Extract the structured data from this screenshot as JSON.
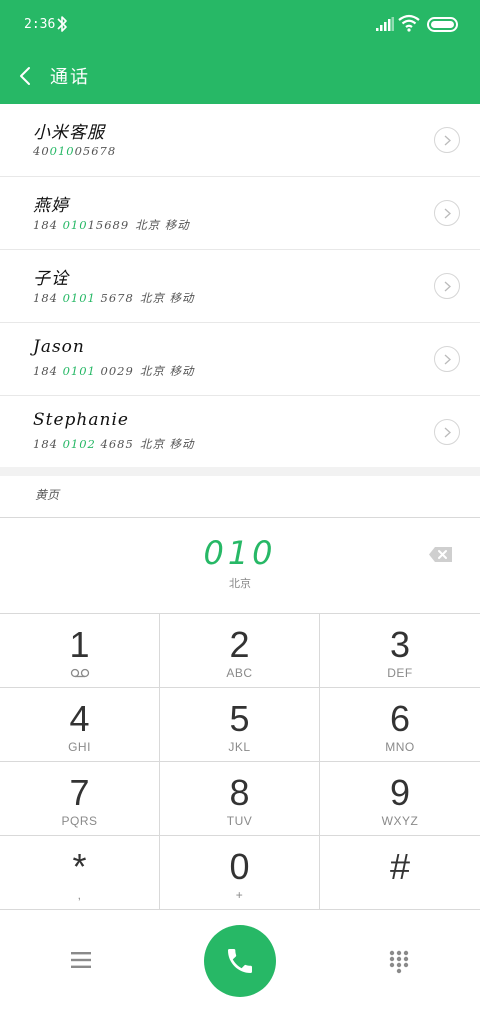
{
  "status_bar": {
    "time": "2:36",
    "icons": [
      "bluetooth-icon",
      "signal-icon",
      "wifi-icon",
      "battery-icon"
    ]
  },
  "header": {
    "title": "通话",
    "back_icon": "chevron-left-icon"
  },
  "contacts": [
    {
      "name": "小米客服",
      "num_pre": "40",
      "num_hl": "010",
      "num_post": "05678",
      "location": ""
    },
    {
      "name": "燕婷",
      "num_pre": "184 ",
      "num_hl": "010",
      "num_post": "15689",
      "location": "北京 移动"
    },
    {
      "name": "子诠",
      "num_pre": "184 ",
      "num_hl": "0101",
      "num_post": " 5678",
      "location": "北京 移动"
    },
    {
      "name": "Jason",
      "num_pre": "184 ",
      "num_hl": "0101",
      "num_post": " 0029",
      "location": "北京 移动"
    },
    {
      "name": "Stephanie",
      "num_pre": "184 ",
      "num_hl": "0102",
      "num_post": " 4685",
      "location": "北京 移动"
    }
  ],
  "yellow_pages": {
    "label": "黄页"
  },
  "dial_display": {
    "number": "010",
    "area": "北京",
    "delete_icon": "backspace-icon"
  },
  "keypad": [
    {
      "digit": "1",
      "letters": ""
    },
    {
      "digit": "2",
      "letters": "ABC"
    },
    {
      "digit": "3",
      "letters": "DEF"
    },
    {
      "digit": "4",
      "letters": "GHI"
    },
    {
      "digit": "5",
      "letters": "JKL"
    },
    {
      "digit": "6",
      "letters": "MNO"
    },
    {
      "digit": "7",
      "letters": "PQRS"
    },
    {
      "digit": "8",
      "letters": "TUV"
    },
    {
      "digit": "9",
      "letters": "WXYZ"
    },
    {
      "digit": "*",
      "letters": ","
    },
    {
      "digit": "0",
      "letters": "+"
    },
    {
      "digit": "#",
      "letters": ""
    }
  ],
  "bottom_bar": {
    "left_icon": "menu-icon",
    "center_icon": "phone-icon",
    "right_icon": "dialpad-icon"
  },
  "colors": {
    "accent": "#27b866",
    "divider": "#d9d9d9"
  }
}
